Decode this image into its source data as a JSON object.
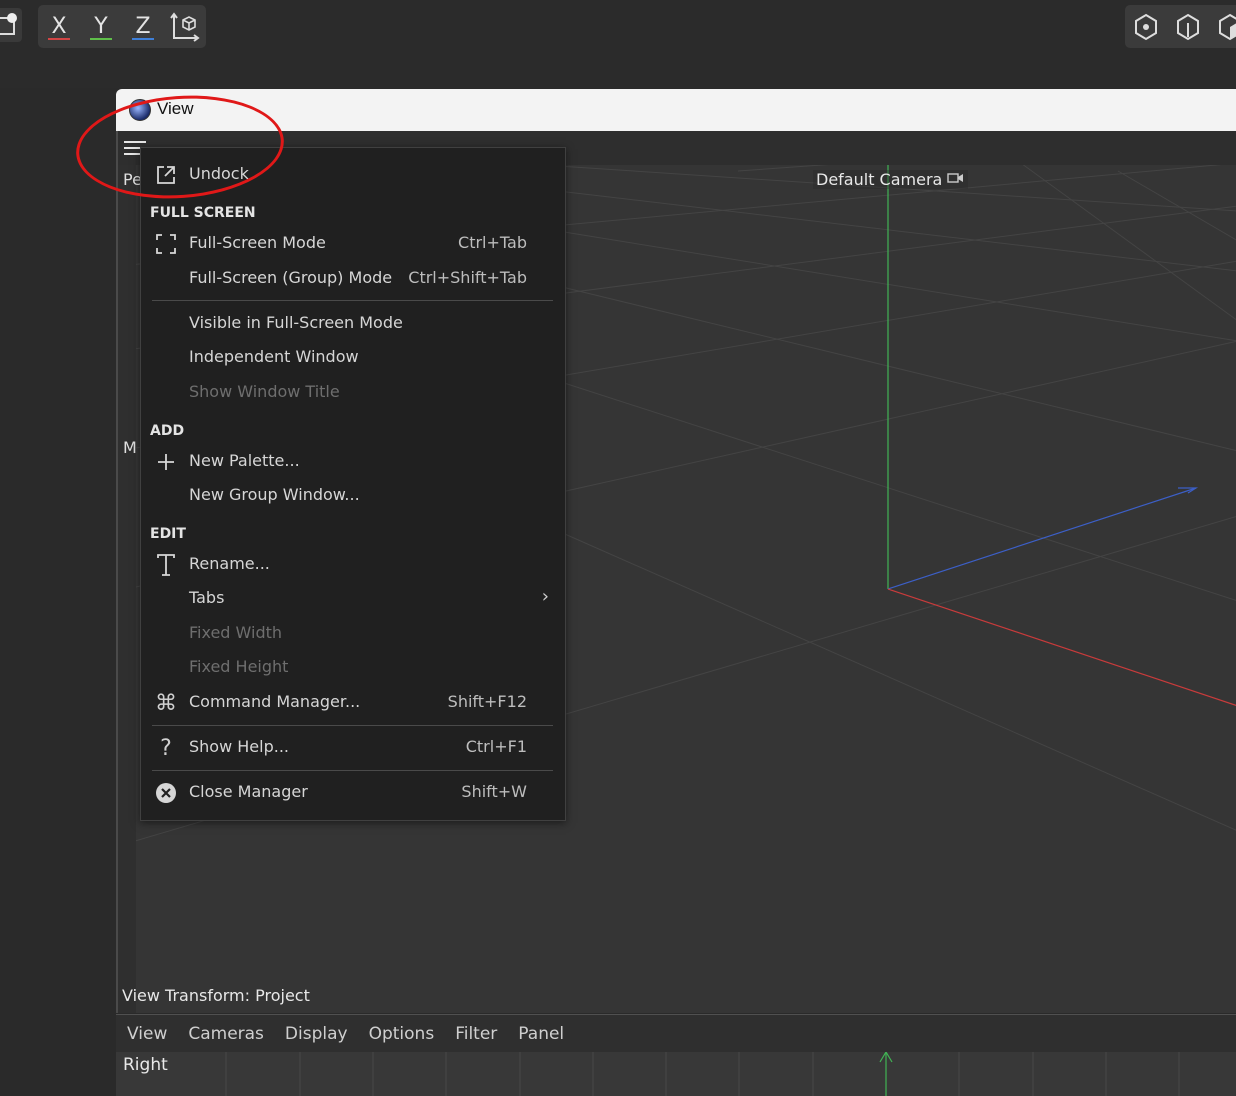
{
  "toolbar": {
    "axes": [
      {
        "label": "X",
        "color": "#d24545"
      },
      {
        "label": "Y",
        "color": "#5fbf4a"
      },
      {
        "label": "Z",
        "color": "#3e7fd8"
      }
    ],
    "icons": [
      "camera-dot-icon",
      "world-axis-icon",
      "cube-outline-icon",
      "cube-half-icon",
      "cube-solid-icon"
    ]
  },
  "window": {
    "title": "View"
  },
  "viewport": {
    "camera_label": "Default Camera",
    "partial_top_label": "Pe",
    "partial_mid_label": "M",
    "view_transform": "View Transform: Project"
  },
  "menu": {
    "undock": "Undock",
    "sections": {
      "full_screen": "FULL SCREEN",
      "add": "ADD",
      "edit": "EDIT"
    },
    "items": {
      "full_screen_mode": {
        "label": "Full-Screen Mode",
        "shortcut": "Ctrl+Tab"
      },
      "full_screen_group_mode": {
        "label": "Full-Screen (Group) Mode",
        "shortcut": "Ctrl+Shift+Tab"
      },
      "visible_in_full_screen": {
        "label": "Visible in Full-Screen Mode"
      },
      "independent_window": {
        "label": "Independent Window"
      },
      "show_window_title": {
        "label": "Show Window Title"
      },
      "new_palette": {
        "label": "New Palette..."
      },
      "new_group_window": {
        "label": "New Group Window..."
      },
      "rename": {
        "label": "Rename..."
      },
      "tabs": {
        "label": "Tabs"
      },
      "fixed_width": {
        "label": "Fixed Width"
      },
      "fixed_height": {
        "label": "Fixed Height"
      },
      "command_manager": {
        "label": "Command Manager...",
        "shortcut": "Shift+F12"
      },
      "show_help": {
        "label": "Show Help...",
        "shortcut": "Ctrl+F1"
      },
      "close_manager": {
        "label": "Close Manager",
        "shortcut": "Shift+W"
      }
    }
  },
  "bottom_view": {
    "menubar": [
      "View",
      "Cameras",
      "Display",
      "Options",
      "Filter",
      "Panel"
    ],
    "label": "Right"
  },
  "colors": {
    "annotation": "#e01818",
    "axis_x": "#d24545",
    "axis_y": "#5fbf4a",
    "axis_z": "#3e7fd8"
  }
}
